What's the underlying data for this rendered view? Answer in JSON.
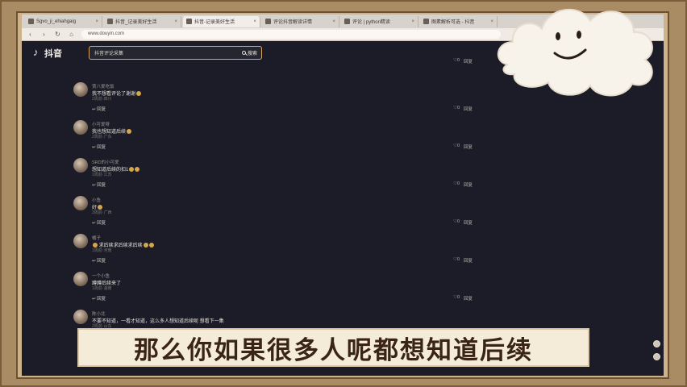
{
  "browser": {
    "tabs": [
      "Sgvo_ji_ehiahgaig",
      "抖音_记录美好生活",
      "抖音-记录美好生活",
      "评论抖音解读详情",
      "评论 | python精读",
      "图素解析可选 - 抖音"
    ],
    "url": "www.douyin.com"
  },
  "header": {
    "logo_text": "抖音",
    "search_value": "抖音评论采集",
    "search_button": "搜索"
  },
  "comments": [
    {
      "reply": "3 回复",
      "user": "",
      "text": "",
      "meta": "",
      "like": "0",
      "action": "回复"
    },
    {
      "reply": "",
      "user": "贾八爱吃饭",
      "text": "我不想看评论了谢谢",
      "meta": "2周前·四川",
      "like": "0",
      "action": "回复",
      "reply_link": "回复"
    },
    {
      "reply": "",
      "user": "小可爱呀",
      "text": "我也想知道后续",
      "meta": "2周前·广东",
      "like": "0",
      "action": "回复",
      "reply_link": "回复"
    },
    {
      "reply": "",
      "user": "SRD的小可爱",
      "text": "想知道后续的扣1",
      "meta": "1周前·江苏",
      "like": "0",
      "action": "回复",
      "reply_link": "回复"
    },
    {
      "reply": "",
      "user": "小鱼",
      "text": "好",
      "meta": "3周前·广西",
      "like": "0",
      "action": "回复",
      "reply_link": "回复"
    },
    {
      "reply": "",
      "user": "橘子",
      "text": "求后续求后续求后续",
      "meta": "1周前·河南",
      "like": "0",
      "action": "回复",
      "reply_link": "回复"
    },
    {
      "reply": "",
      "user": "一个小鱼",
      "text": "蹲蹲后续来了",
      "meta": "1周前·湖南",
      "like": "0",
      "action": "回复",
      "reply_link": "回复"
    },
    {
      "reply": "",
      "user": "陈小北",
      "text": "不要不知道，一看才知道，这么多人想知道后续呢 想看下一集",
      "meta": "2周前·山东",
      "like": "",
      "action": "",
      "reply_link": ""
    }
  ],
  "subtitle": "那么你如果很多人呢都想知道后续"
}
